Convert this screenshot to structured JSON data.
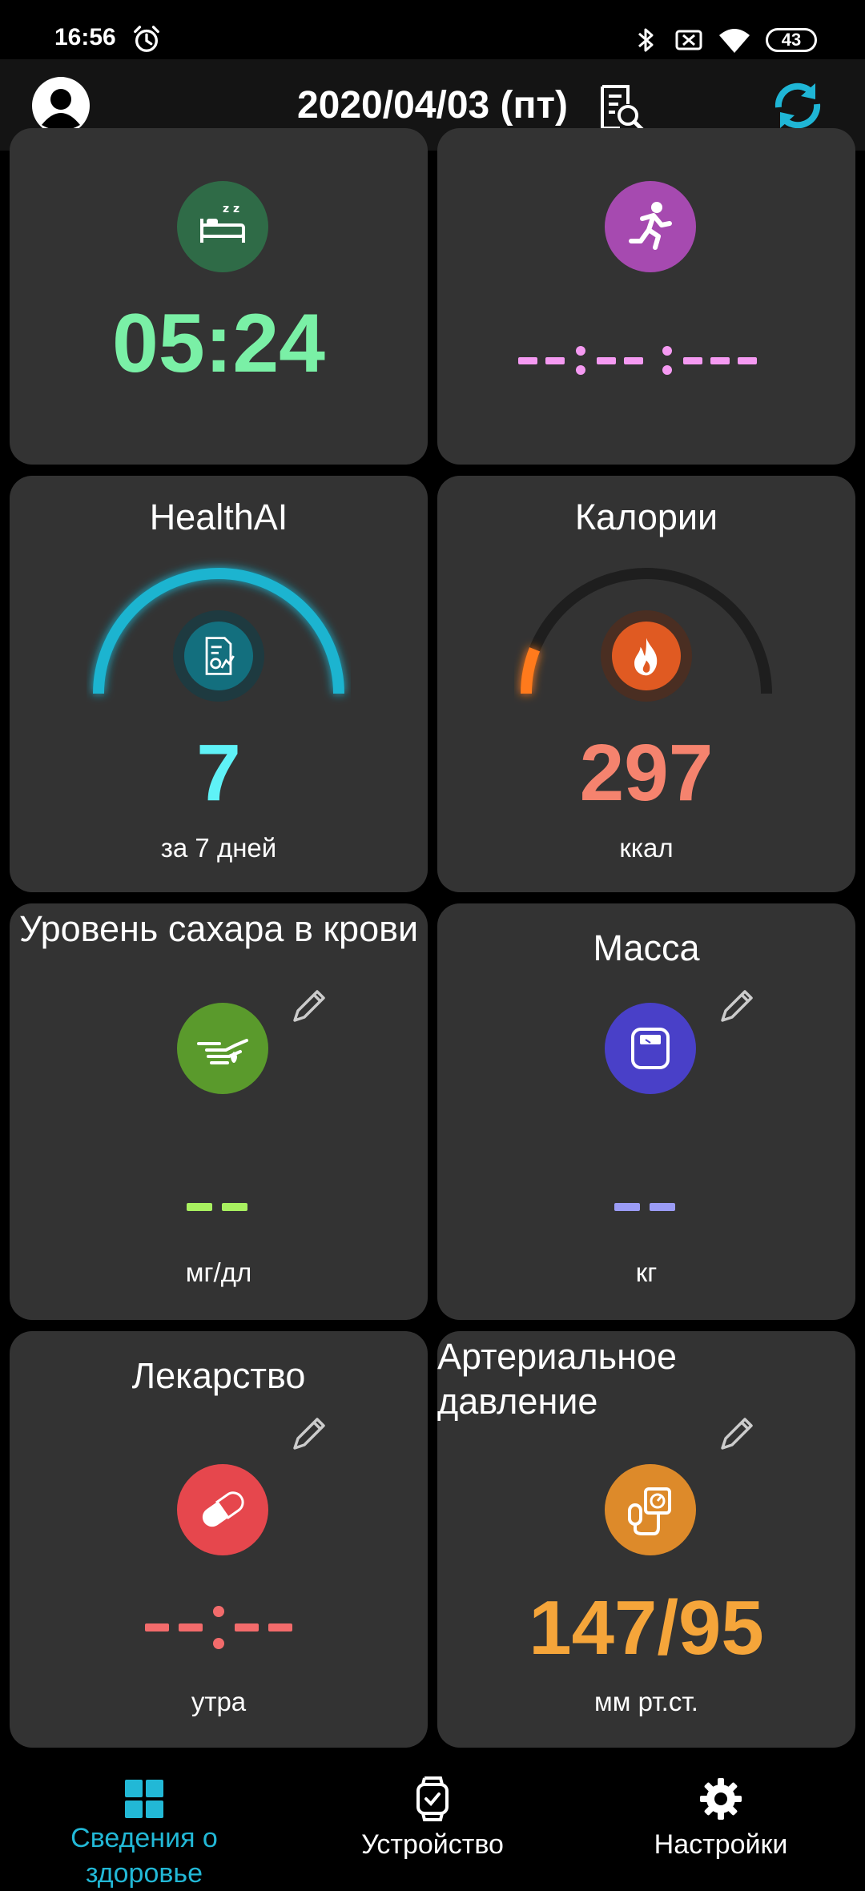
{
  "status_bar": {
    "time": "16:56",
    "battery": "43",
    "icons": [
      "alarm-icon",
      "bluetooth-icon",
      "sim-off-icon",
      "wifi-icon",
      "battery-icon"
    ]
  },
  "app_bar": {
    "date": "2020/04/03 (пт)",
    "icons": [
      "avatar-icon",
      "search-document-icon",
      "sync-icon"
    ]
  },
  "cards": {
    "sleep": {
      "value": "05:24",
      "icon": "sleep-bed-icon",
      "color": "#7af0a6"
    },
    "exercise": {
      "icon": "running-icon",
      "color": "#f59af2"
    },
    "healthai": {
      "title": "HealthAI",
      "value": "7",
      "unit": "за 7 дней",
      "icon": "report-icon",
      "color": "#5ff2f7",
      "gauge_fraction": 1.0
    },
    "calories": {
      "title": "Калории",
      "value": "297",
      "unit": "ккал",
      "icon": "flame-icon",
      "color": "#f5836e",
      "gauge_fraction": 0.12
    },
    "blood_sugar": {
      "title": "Уровень сахара в крови",
      "unit": "мг/дл",
      "icon": "finger-drop-icon",
      "color": "#a8f060"
    },
    "weight": {
      "title": "Масса",
      "unit": "кг",
      "icon": "scale-icon",
      "color": "#9b9cf5"
    },
    "medicine": {
      "title": "Лекарство",
      "unit": "утра",
      "icon": "pill-icon",
      "color": "#f26b6b"
    },
    "blood_pressure": {
      "title": "Артериальное давление",
      "value": "147/95",
      "unit": "мм рт.ст.",
      "icon": "blood-pressure-icon",
      "color": "#f5a53a"
    }
  },
  "bottom_nav": {
    "items": [
      {
        "label": "Сведения о здоровье",
        "icon": "grid-icon",
        "active": true
      },
      {
        "label": "Устройство",
        "icon": "watch-icon",
        "active": false
      },
      {
        "label": "Настройки",
        "icon": "gear-icon",
        "active": false
      }
    ],
    "active_color": "#22b8d6"
  }
}
